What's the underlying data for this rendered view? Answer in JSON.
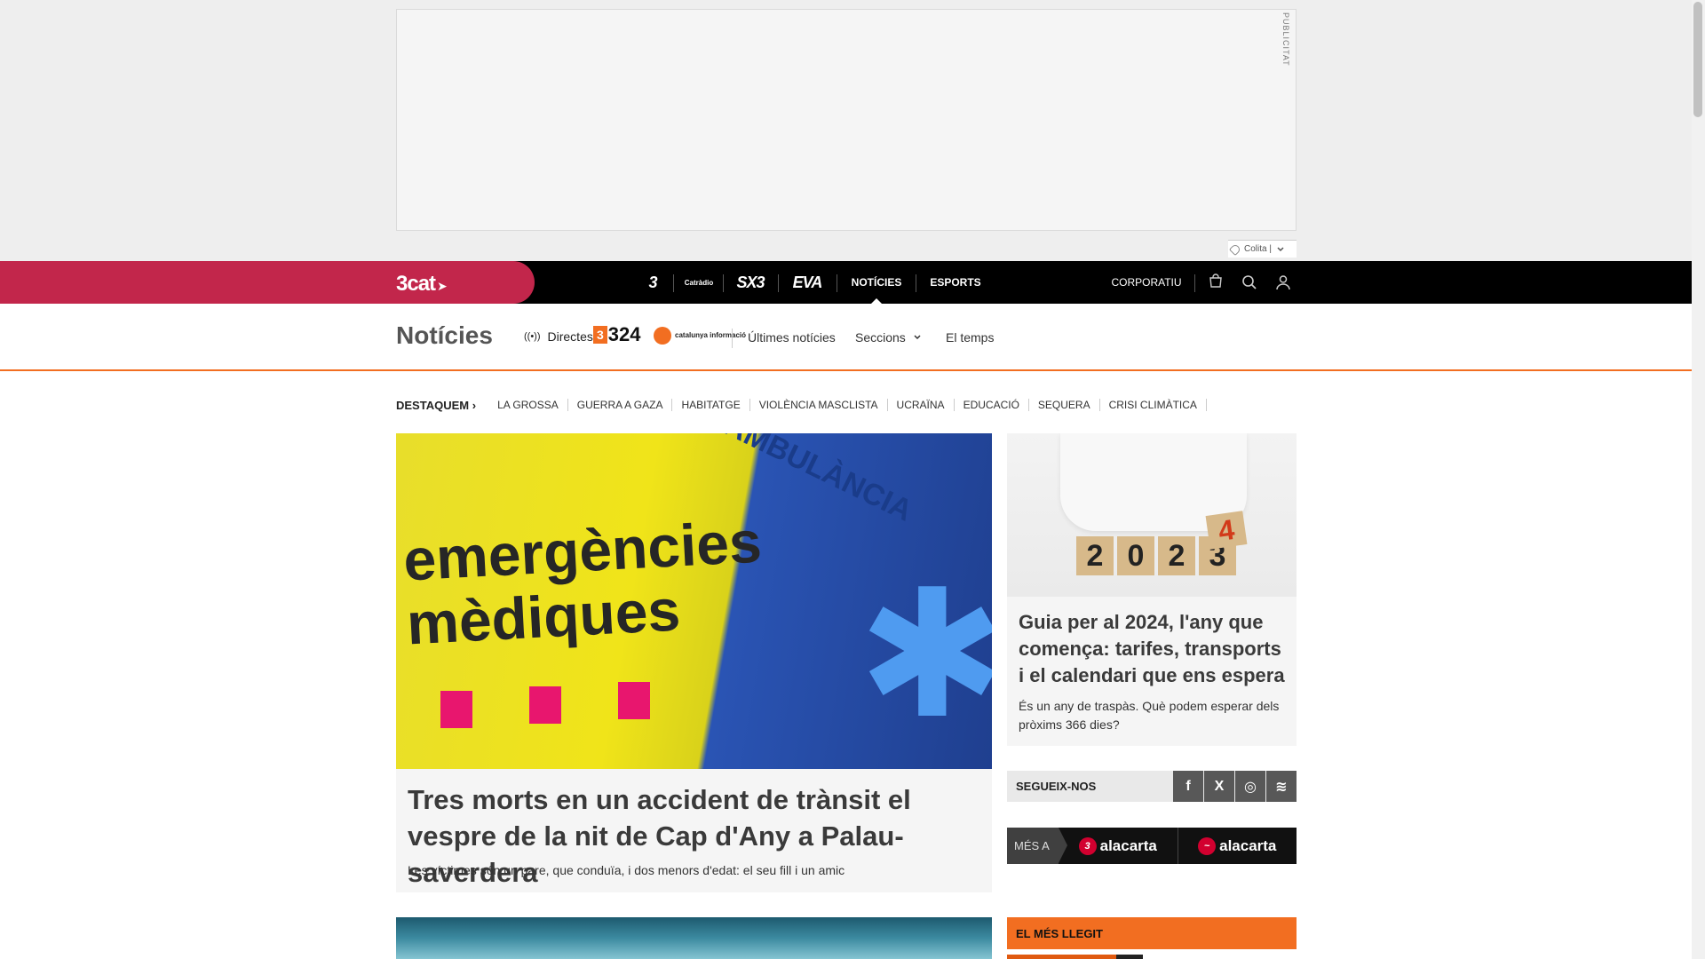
{
  "ad": {
    "label": "PUBLICITAT",
    "colita_label": "Colita |"
  },
  "topbar": {
    "logo": "3cat",
    "channels": [
      {
        "name": "3",
        "icon": "tv3-logo"
      },
      {
        "name": "Catràdio",
        "icon": "catradio-logo"
      },
      {
        "name": "SX3",
        "icon": "sx3-logo"
      },
      {
        "name": "EVA",
        "icon": "eva-logo"
      }
    ],
    "nav": {
      "noticies": "NOTÍCIES",
      "esports": "ESPORTS",
      "corporatiu": "CORPORATIU"
    }
  },
  "section": {
    "title": "Notícies",
    "directes": "Directes",
    "logo_324": "324",
    "catinfo": "catalunya informació",
    "links": {
      "ultimes": "Últimes notícies",
      "seccions": "Seccions",
      "temps": "El temps"
    }
  },
  "tags": {
    "label": "DESTAQUEM",
    "items": [
      "LA GROSSA",
      "GUERRA A GAZA",
      "HABITATGE",
      "VIOLÈNCIA MASCLISTA",
      "UCRAÏNA",
      "EDUCACIÓ",
      "SEQUERA",
      "CRISI CLIMÀTICA"
    ]
  },
  "main_article": {
    "image_text_line1": "emergències",
    "image_text_line2": "mèdiques",
    "image_side_text": "AMBULÀNCIA",
    "title": "Tres morts en un accident de trànsit el vespre de la nit de Cap d'Any a Palau-saverdera",
    "subtitle": "Les víctimes són un pare, que conduïa, i dos menors d'edat: el seu fill i un amic"
  },
  "side_article": {
    "image_digits": [
      "2",
      "0",
      "2",
      "3"
    ],
    "image_digit_new": "4",
    "title": "Guia per al 2024, l'any que comença: tarifes, transports i el calendari que ens espera",
    "subtitle": "És un any de traspàs. Què podem esperar dels pròxims 366 dies?"
  },
  "social": {
    "label": "SEGUEIX-NOS",
    "buttons": [
      {
        "glyph": "f",
        "icon": "facebook-icon"
      },
      {
        "glyph": "X",
        "icon": "x-icon"
      },
      {
        "glyph": "◎",
        "icon": "instagram-icon"
      },
      {
        "glyph": "≋",
        "icon": "rss-icon"
      }
    ]
  },
  "mes_a": {
    "label": "MÉS A",
    "items": [
      {
        "badge": "3",
        "text": "alacarta"
      },
      {
        "badge": "~",
        "text": "alacarta"
      }
    ]
  },
  "mes_llegit": {
    "label": "EL MÉS LLEGIT"
  },
  "colors": {
    "brand_red": "#c2264b",
    "accent_orange": "#f26e21",
    "topbar": "#000000"
  }
}
